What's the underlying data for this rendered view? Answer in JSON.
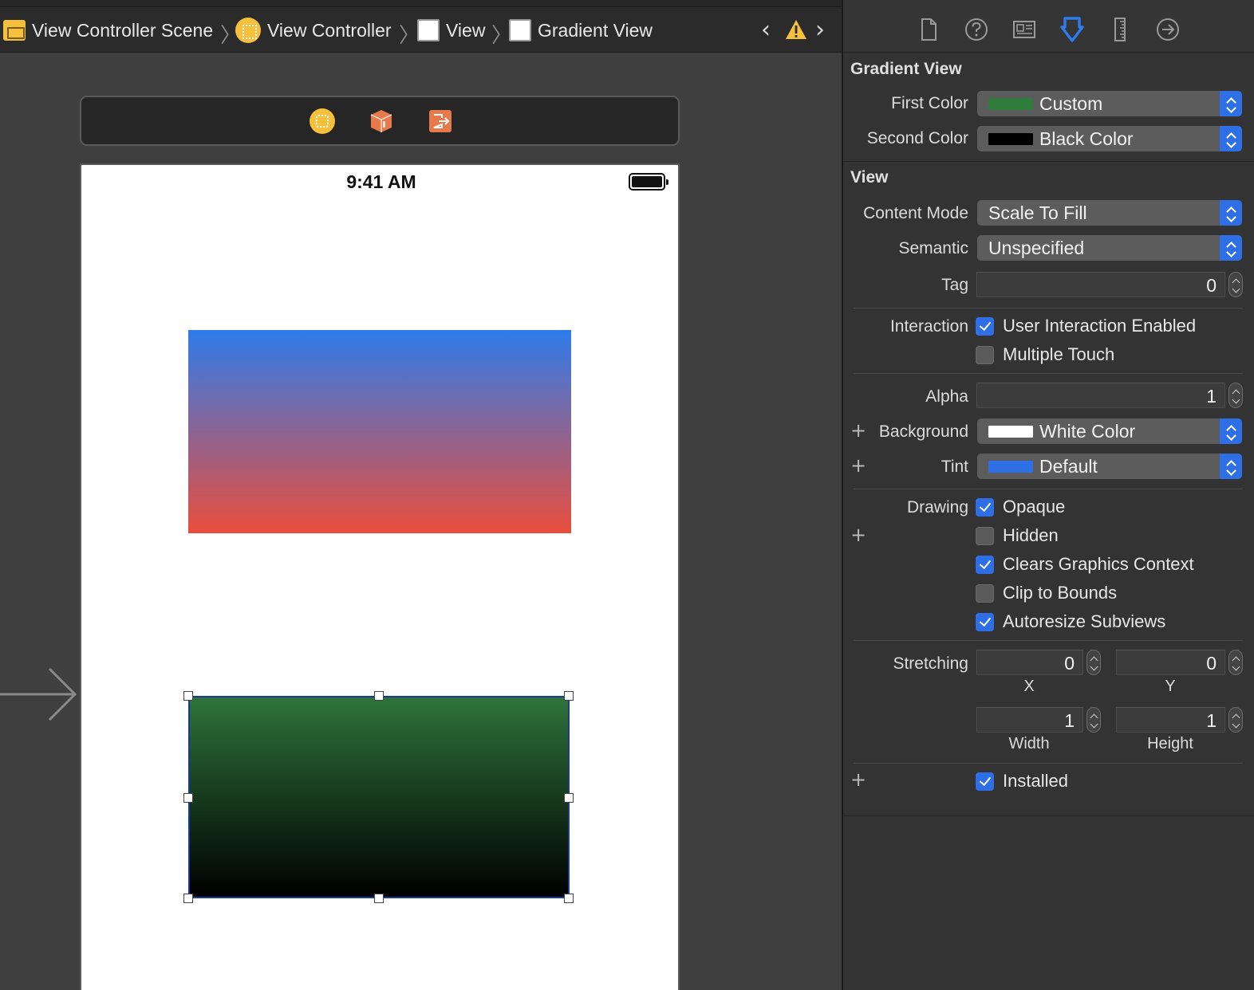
{
  "jumpbar": {
    "crumbs": [
      "View Controller Scene",
      "View Controller",
      "View",
      "Gradient View"
    ]
  },
  "canvas": {
    "status_time": "9:41 AM",
    "top_gradient": {
      "start": "#2f7bec",
      "end": "#e94e3c"
    },
    "bottom_gradient": {
      "start": "#2e733a",
      "end": "#000000"
    }
  },
  "inspector": {
    "gradient_section": {
      "title": "Gradient View",
      "first_color": {
        "label": "First Color",
        "value": "Custom",
        "swatch": "#2e7d3a"
      },
      "second_color": {
        "label": "Second Color",
        "value": "Black Color",
        "swatch": "#000000"
      }
    },
    "view_section": {
      "title": "View",
      "content_mode": {
        "label": "Content Mode",
        "value": "Scale To Fill"
      },
      "semantic": {
        "label": "Semantic",
        "value": "Unspecified"
      },
      "tag": {
        "label": "Tag",
        "value": "0"
      },
      "interaction": {
        "label": "Interaction",
        "user_interaction": {
          "label": "User Interaction Enabled",
          "checked": true
        },
        "multiple_touch": {
          "label": "Multiple Touch",
          "checked": false
        }
      },
      "alpha": {
        "label": "Alpha",
        "value": "1"
      },
      "background": {
        "label": "Background",
        "value": "White Color",
        "swatch": "#ffffff"
      },
      "tint": {
        "label": "Tint",
        "value": "Default",
        "swatch": "#2f6fe6"
      },
      "drawing": {
        "label": "Drawing",
        "opaque": {
          "label": "Opaque",
          "checked": true
        },
        "hidden": {
          "label": "Hidden",
          "checked": false
        },
        "clears": {
          "label": "Clears Graphics Context",
          "checked": true
        },
        "clip": {
          "label": "Clip to Bounds",
          "checked": false
        },
        "autoresize": {
          "label": "Autoresize Subviews",
          "checked": true
        }
      },
      "stretching": {
        "label": "Stretching",
        "x": "0",
        "y": "0",
        "width": "1",
        "height": "1",
        "x_label": "X",
        "y_label": "Y",
        "width_label": "Width",
        "height_label": "Height"
      },
      "installed": {
        "label": "Installed",
        "checked": true
      }
    }
  },
  "colors": {
    "accent": "#2f6fe6",
    "warning": "#f4c03e"
  }
}
